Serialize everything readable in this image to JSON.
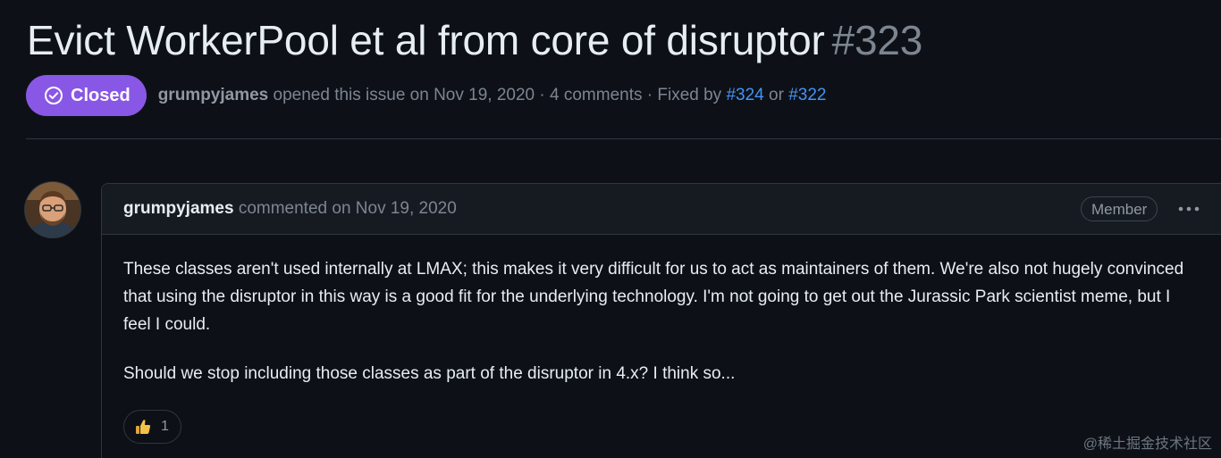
{
  "issue": {
    "title": "Evict WorkerPool et al from core of disruptor",
    "number": "#323",
    "state": "Closed",
    "state_color": "#8957e5",
    "author": "grumpyjames",
    "opened_text": "opened this issue on Nov 19, 2020 · 4 comments · Fixed by",
    "fixed_by": [
      "#324",
      "#322"
    ],
    "fixed_by_joiner": "or"
  },
  "comment": {
    "author": "grumpyjames",
    "timestamp_text": "commented on Nov 19, 2020",
    "role": "Member",
    "menu_icon": "kebab-horizontal-icon",
    "paragraphs": [
      "These classes aren't used internally at LMAX; this makes it very difficult for us to act as maintainers of them. We're also not hugely convinced that using the disruptor in this way is a good fit for the underlying technology. I'm not going to get out the Jurassic Park scientist meme, but I feel I could.",
      "Should we stop including those classes as part of the disruptor in 4.x? I think so..."
    ],
    "reactions": [
      {
        "emoji": "thumbs-up-icon",
        "count": "1"
      }
    ]
  },
  "watermark": "@稀土掘金技术社区",
  "colors": {
    "background": "#0d1117",
    "header_bg": "#161b22",
    "border": "#30363d",
    "link": "#4493f8",
    "muted": "#7d8590"
  }
}
